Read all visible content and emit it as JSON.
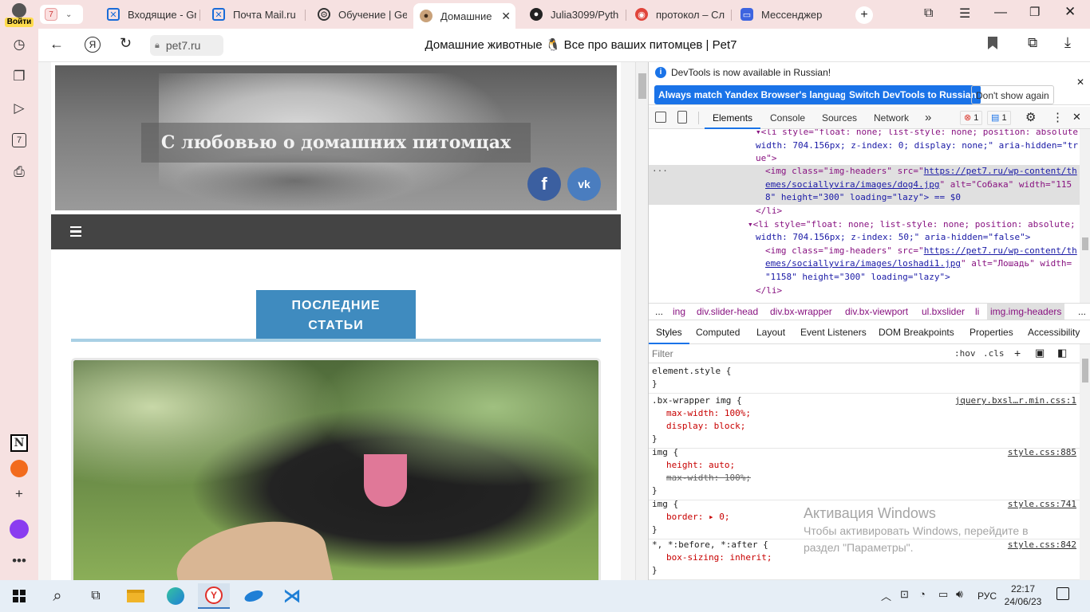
{
  "browser": {
    "login_label": "Войти",
    "tab_counter": "7",
    "tabs": [
      {
        "label": "Входящие - Gm",
        "icon": "mail-icon"
      },
      {
        "label": "Почта Mail.ru",
        "icon": "mail-icon"
      },
      {
        "label": "Обучение | Ge",
        "icon": "gear-icon"
      },
      {
        "label": "Домашние",
        "icon": "pug-icon"
      },
      {
        "label": "Julia3099/Pyth",
        "icon": "github-icon"
      },
      {
        "label": "протокол – Сл",
        "icon": "chrome-icon"
      },
      {
        "label": "Мессенджер",
        "icon": "messenger-icon"
      }
    ],
    "address": "pet7.ru",
    "page_title": "Домашние животные 🐧 Все про ваших питомцев | Pet7",
    "rail_calendar_day": "7"
  },
  "site": {
    "header_slogan": "С любовью о домашних питомцах",
    "menu_icon": "hamburger-icon",
    "section_heading_line1": "ПОСЛЕДНИЕ",
    "section_heading_line2": "СТАТЬИ",
    "social": [
      "facebook-icon",
      "vk-icon"
    ]
  },
  "devtools": {
    "banner_text": "DevTools is now available in Russian!",
    "banner_btn1": "Always match Yandex Browser's language",
    "banner_btn2": "Switch DevTools to Russian",
    "banner_btn3": "Don't show again",
    "tabs": [
      "Elements",
      "Console",
      "Sources",
      "Network"
    ],
    "error_count": "1",
    "message_count": "1",
    "breadcrumbs": [
      "...",
      "ing",
      "div.slider-head",
      "div.bx-wrapper",
      "div.bx-viewport",
      "ul.bxslider",
      "li",
      "img.img-headers",
      "..."
    ],
    "subtabs": [
      "Styles",
      "Computed",
      "Layout",
      "Event Listeners",
      "DOM Breakpoints",
      "Properties",
      "Accessibility"
    ],
    "filter_placeholder": "Filter",
    "hov": ":hov",
    "cls": ".cls",
    "dom": {
      "l1a": "<li style=\"float: none; list-style: none; position: absolute;",
      "l1b": "width: 704.156px; z-index: 0; display: none;\" aria-hidden=\"tr",
      "l1c": "ue\">",
      "img1_attr": "<img class=\"img-headers\" src=\"",
      "img1_url1": "https://pet7.ru/wp-content/th",
      "img1_url2": "emes/sociallyvira/images/dog4.jpg",
      "img1_rest": "\" alt=\"Собака\" width=\"115",
      "img1_l3": "8\" height=\"300\" loading=\"lazy\"> == $0",
      "li_close": "</li>",
      "l2a": "<li style=\"float: none; list-style: none; position: absolute;",
      "l2b": "width: 704.156px; z-index: 50;\" aria-hidden=\"false\">",
      "img2_attr": "<img class=\"img-headers\" src=\"",
      "img2_url1": "https://pet7.ru/wp-content/th",
      "img2_url2": "emes/sociallyvira/images/loshadi1.jpg",
      "img2_rest": "\" alt=\"Лошадь\" width=",
      "img2_l3": "\"1158\" height=\"300\" loading=\"lazy\">",
      "li_close2": "</li>"
    },
    "styles": [
      {
        "selector": "element.style {",
        "src": "",
        "props": []
      },
      {
        "selector": ".bx-wrapper img {",
        "src": "jquery.bxsl…r.min.css:1",
        "props": [
          "max-width: 100%;",
          "display: block;"
        ]
      },
      {
        "selector": "img {",
        "src": "style.css:885",
        "props": [
          "height: auto;",
          "max-width: 100%;"
        ]
      },
      {
        "selector": "img {",
        "src": "style.css:741",
        "props": [
          "border: ▸ 0;"
        ]
      },
      {
        "selector": "*, *:before, *:after {",
        "src": "style.css:842",
        "props": [
          "box-sizing: inherit;"
        ]
      }
    ],
    "close_brace": "}"
  },
  "watermark": {
    "title": "Активация Windows",
    "line1": "Чтобы активировать Windows, перейдите в",
    "line2": "раздел \"Параметры\"."
  },
  "taskbar": {
    "lang": "РУС",
    "time": "22:17",
    "date": "24/06/23"
  },
  "colors": {
    "accent_blue": "#3c8dbc",
    "chrome_bg": "#f6e1e1",
    "nav_dark": "#444444"
  }
}
